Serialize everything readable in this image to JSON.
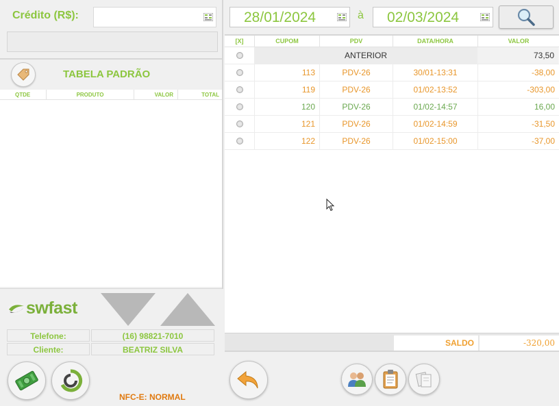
{
  "credit": {
    "label": "Crédito (R$):",
    "value": ""
  },
  "table_title": "TABELA PADRÃO",
  "order_columns": [
    "QTDE",
    "PRODUTO",
    "VALOR",
    "TOTAL"
  ],
  "brand": {
    "logo_text": "swfast",
    "color": "#7bb03a"
  },
  "info": {
    "phone_label": "Telefone:",
    "phone_value": "(16) 98821-7010",
    "client_label": "Cliente:",
    "client_value": "BEATRIZ SILVA"
  },
  "nfce_status": "NFC-E: NORMAL",
  "filter": {
    "date_from": "28/01/2024",
    "separator": "à",
    "date_to": "02/03/2024"
  },
  "grid": {
    "columns": [
      "[X]",
      "CUPOM",
      "PDV",
      "DATA/HORA",
      "VALOR"
    ],
    "anterior": {
      "label": "ANTERIOR",
      "valor": "73,50"
    },
    "rows": [
      {
        "cupom": "113",
        "pdv": "PDV-26",
        "data": "30/01-13:31",
        "valor": "-38,00"
      },
      {
        "cupom": "119",
        "pdv": "PDV-26",
        "data": "01/02-13:52",
        "valor": "-303,00"
      },
      {
        "cupom": "120",
        "pdv": "PDV-26",
        "data": "01/02-14:57",
        "valor": "16,00"
      },
      {
        "cupom": "121",
        "pdv": "PDV-26",
        "data": "01/02-14:59",
        "valor": "-31,50"
      },
      {
        "cupom": "122",
        "pdv": "PDV-26",
        "data": "01/02-15:00",
        "valor": "-37,00"
      }
    ]
  },
  "saldo": {
    "label": "SALDO",
    "value": "-320,00"
  },
  "colors": {
    "accent_green": "#8cc63f",
    "accent_orange": "#e8962a",
    "positive_green": "#6aa84f"
  }
}
